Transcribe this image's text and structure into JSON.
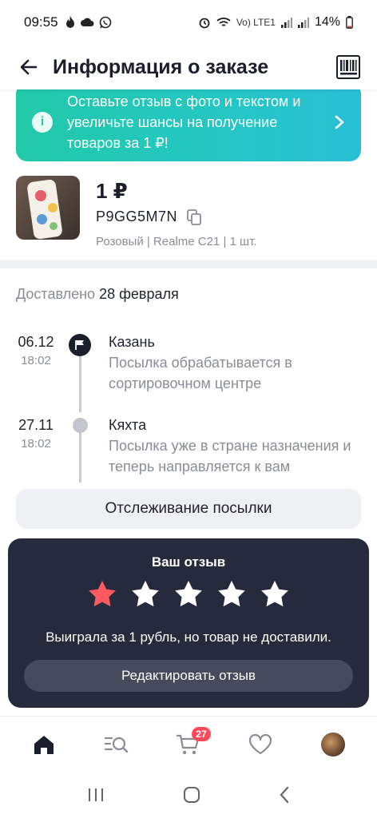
{
  "status_bar": {
    "time": "09:55",
    "network": "Vo) LTE1",
    "battery": "14%"
  },
  "header": {
    "title": "Информация о заказе",
    "icons": {
      "back": "arrow-left-icon",
      "barcode": "barcode-icon"
    }
  },
  "promo": {
    "text": "Оставьте отзыв с фото и текстом и увеличьте шансы на получение товаров за 1 ₽!",
    "colors": {
      "start": "#22c9a8",
      "end": "#29c0d6"
    }
  },
  "product": {
    "price": "1 ₽",
    "code": "P9GG5M7N",
    "meta": "Розовый | Realme C21 | 1 шт."
  },
  "delivery": {
    "prefix": "Доставлено",
    "date": "28 февраля"
  },
  "tracking": [
    {
      "day": "06.12",
      "time": "18:02",
      "city": "Казань",
      "description": "Посылка обрабатывается в сортировочном центре",
      "icon": "flag-icon"
    },
    {
      "day": "27.11",
      "time": "18:02",
      "city": "Кяхта",
      "description": "Посылка уже в стране назначения и теперь направляется к вам",
      "icon": "dot-icon"
    }
  ],
  "track_button_label": "Отслеживание посылки",
  "review": {
    "title": "Ваш отзыв",
    "rating": 1,
    "max_rating": 5,
    "text": "Выиграла за 1 рубль, но товар не доставили.",
    "edit_button_label": "Редактировать отзыв",
    "colors": {
      "active_star": "#ff5a5f",
      "inactive_star": "#ffffff",
      "card": "#262a3d"
    }
  },
  "bottom_nav": {
    "items": [
      "home-icon",
      "catalog-search-icon",
      "cart-icon",
      "favorites-heart-icon",
      "profile-avatar"
    ],
    "cart_badge": "27"
  },
  "android_nav": [
    "recent-apps-icon",
    "home-circle-icon",
    "back-chevron-icon"
  ]
}
